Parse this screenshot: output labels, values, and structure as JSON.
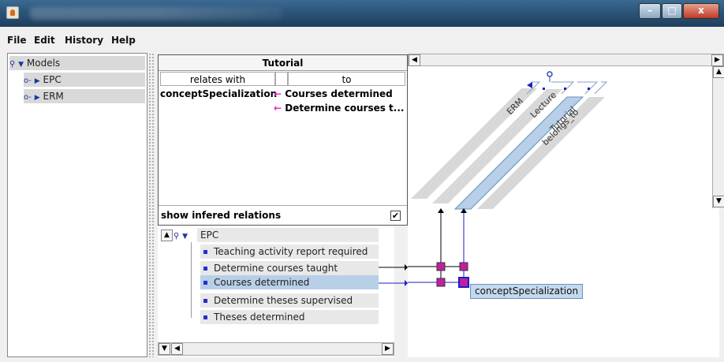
{
  "window": {
    "title": "",
    "minimize_glyph": "–",
    "maximize_glyph": "□",
    "close_glyph": "x"
  },
  "menu": [
    "File",
    "Edit",
    "History",
    "Help"
  ],
  "model_tree": {
    "root": "Models",
    "children": [
      "EPC",
      "ERM"
    ]
  },
  "relation_panel": {
    "title": "Tutorial",
    "col_relates_with": "relates with",
    "col_to": "to",
    "relation_name": "conceptSpecialization",
    "targets": [
      "Courses determined",
      "Determine courses t..."
    ],
    "show_inferred_label": "show infered relations",
    "show_inferred_checked": "✔"
  },
  "graph": {
    "columns": [
      "ERM",
      "Lecture",
      "Tutorial",
      "belongs_to"
    ],
    "tooltip": "conceptSpecialization",
    "colors": {
      "black_line": "#000000",
      "blue_line": "#1c1cc8",
      "marker": "#c020a0",
      "selected_column": "#b8cfe8",
      "column": "#d8d8d8"
    }
  },
  "epc_tree": {
    "root": "EPC",
    "items": [
      "Teaching activity report required",
      "Determine courses taught",
      "Courses determined",
      "Determine theses supervised",
      "Theses determined"
    ],
    "selected_index": 2
  }
}
